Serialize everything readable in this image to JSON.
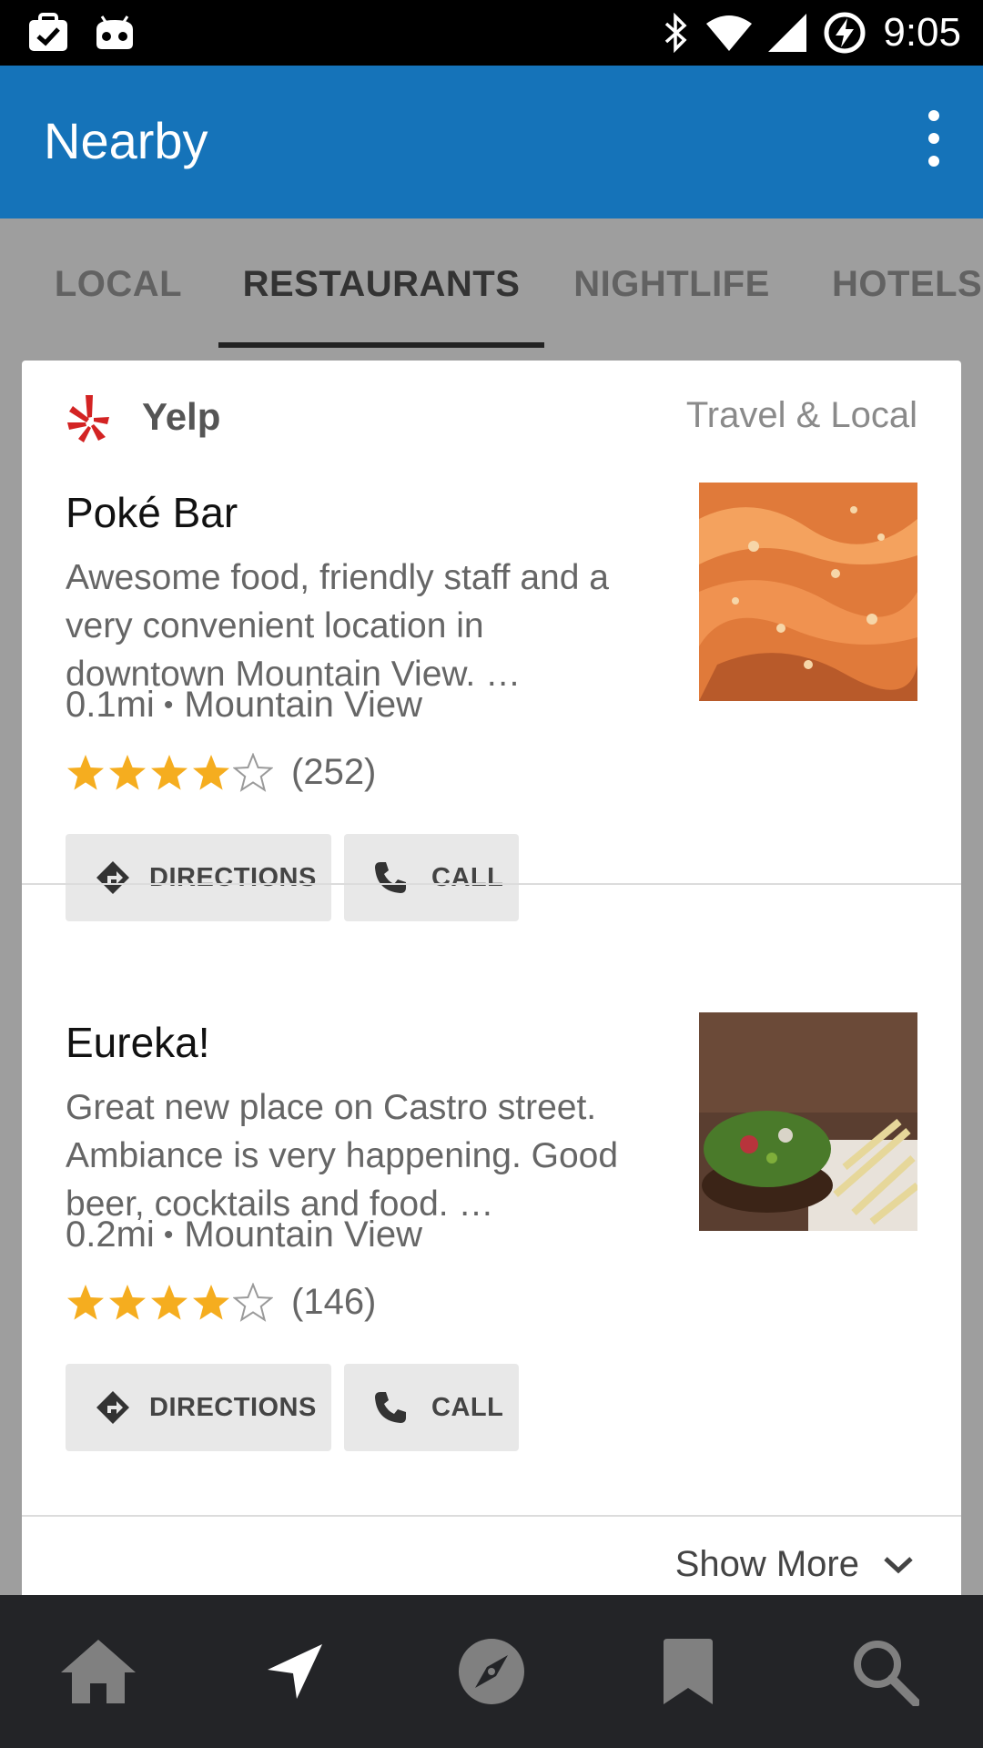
{
  "status_bar": {
    "time": "9:05",
    "left_icons": [
      "clipboard-check-icon",
      "android-icon"
    ],
    "right_icons": [
      "bluetooth-icon",
      "wifi-icon",
      "signal-icon",
      "battery-charging-icon"
    ]
  },
  "app_bar": {
    "title": "Nearby",
    "background": "#1573b9"
  },
  "tabs": [
    {
      "label": "LOCAL",
      "active": false
    },
    {
      "label": "RESTAURANTS",
      "active": true
    },
    {
      "label": "NIGHTLIFE",
      "active": false
    },
    {
      "label": "HOTELS",
      "active": false
    }
  ],
  "card": {
    "source": "Yelp",
    "category": "Travel & Local",
    "items": [
      {
        "title": "Poké Bar",
        "description": "Awesome food, friendly staff and a very convenient location in downtown Mountain View. …",
        "distance": "0.1mi",
        "separator": "•",
        "locality": "Mountain View",
        "rating": 4,
        "rating_max": 5,
        "reviews": "(252)",
        "directions_label": "DIRECTIONS",
        "call_label": "CALL"
      },
      {
        "title": "Eureka!",
        "description": "Great new place on Castro street. Ambiance is very happening. Good beer, cocktails and food. …",
        "distance": "0.2mi",
        "separator": "•",
        "locality": "Mountain View",
        "rating": 4,
        "rating_max": 5,
        "reviews": "(146)",
        "directions_label": "DIRECTIONS",
        "call_label": "CALL"
      }
    ],
    "show_more": "Show More"
  },
  "bottom_nav": [
    "home-icon",
    "navigation-arrow-icon",
    "compass-icon",
    "bookmark-icon",
    "search-icon"
  ],
  "colors": {
    "accent": "#1573b9",
    "star": "#f5ad1f",
    "nav_background": "#232427"
  }
}
